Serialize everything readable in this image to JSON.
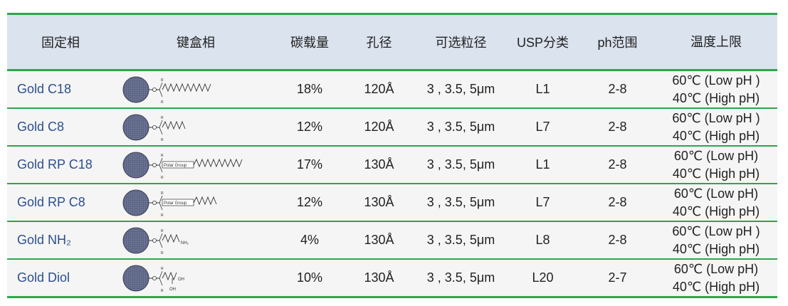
{
  "headers": [
    "固定相",
    "键盒相",
    "碳载量",
    "孔径",
    "可选粒径",
    "USP分类",
    "ph范围",
    "温度上限"
  ],
  "rows": [
    {
      "name": "Gold C18",
      "structure": "silica-bead-c18-chain-icon",
      "carbon": "18%",
      "pore": "120Å",
      "particle": "3 , 3.5, 5μm",
      "usp": "L1",
      "ph": "2-8",
      "temp_low": "60℃ (Low pH )",
      "temp_high": "40℃ (High pH)"
    },
    {
      "name": "Gold C8",
      "structure": "silica-bead-c8-chain-icon",
      "carbon": "12%",
      "pore": "120Å",
      "particle": "3 , 3.5, 5μm",
      "usp": "L7",
      "ph": "2-8",
      "temp_low": "60℃ (Low pH )",
      "temp_high": "40℃ (High pH)"
    },
    {
      "name": "Gold RP C18",
      "structure": "silica-bead-polar-c18-icon",
      "carbon": "17%",
      "pore": "130Å",
      "particle": "3 , 3.5, 5μm",
      "usp": "L1",
      "ph": "2-8",
      "temp_low": "60℃ (Low pH)",
      "temp_high": "40℃ (High pH)"
    },
    {
      "name": "Gold RP C8",
      "structure": "silica-bead-polar-c8-icon",
      "carbon": "12%",
      "pore": "130Å",
      "particle": "3 , 3.5, 5μm",
      "usp": "L7",
      "ph": "2-8",
      "temp_low": "60℃ (Low pH)",
      "temp_high": "40℃ (High pH)"
    },
    {
      "name": "Gold NH₂",
      "structure": "silica-bead-nh2-icon",
      "carbon": "4%",
      "pore": "130Å",
      "particle": "3 , 3.5, 5μm",
      "usp": "L8",
      "ph": "2-8",
      "temp_low": "60℃ (Low pH )",
      "temp_high": "40℃ (High pH)"
    },
    {
      "name": "Gold Diol",
      "structure": "silica-bead-diol-icon",
      "carbon": "10%",
      "pore": "130Å",
      "particle": "3 , 3.5, 5μm",
      "usp": "L20",
      "ph": "2-7",
      "temp_low": "60℃ (Low pH)",
      "temp_high": "40℃ (High pH)"
    }
  ],
  "structure_labels": {
    "r": "R",
    "o": "O",
    "polar": "Polar Group",
    "nh2": "NH₂",
    "oh": "OH"
  },
  "colors": {
    "rule": "#2fa54c",
    "header_bg": "#dbe3ee",
    "row_bg": "#f5f5f5",
    "name": "#2c4f8f",
    "bead": "#6b7494"
  }
}
